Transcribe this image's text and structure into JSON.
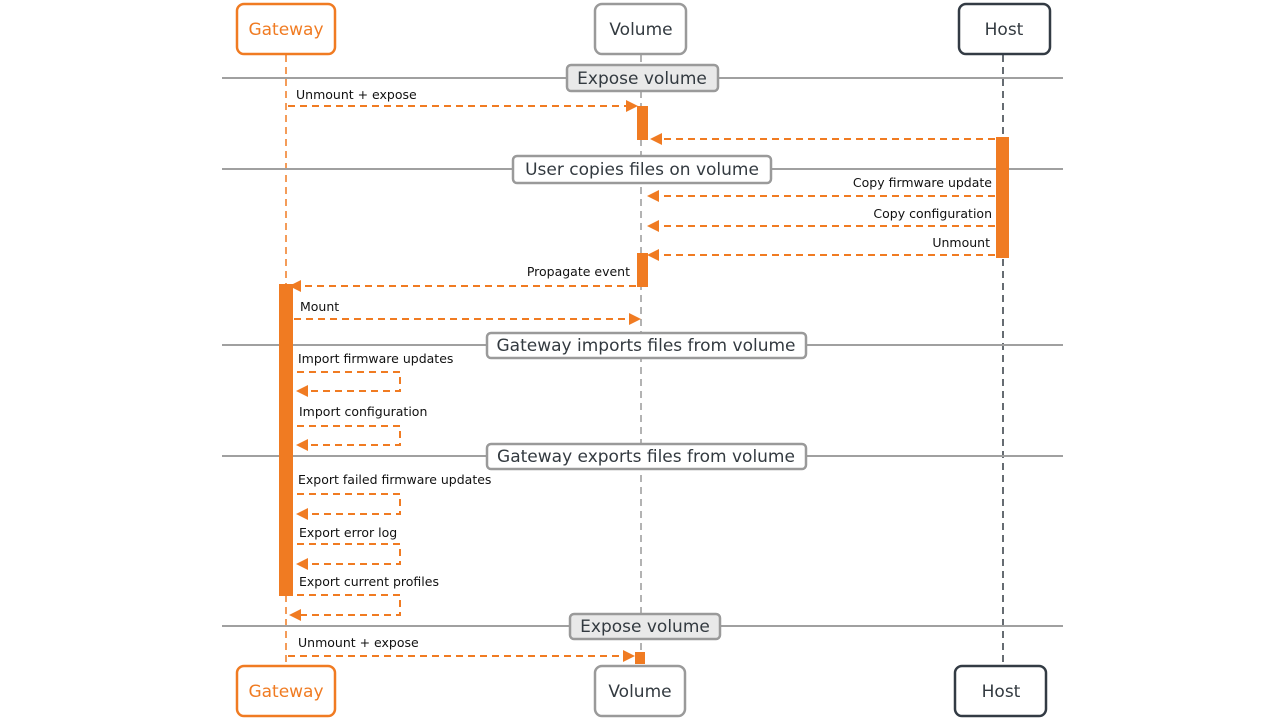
{
  "diagram": {
    "type": "sequence",
    "colors": {
      "accent": "#f07b22",
      "gateway": "#f07b22",
      "volume": "#9a9a9a",
      "host": "#333b44",
      "separator": "#a0a0a0",
      "group_fill_highlight": "#e9e9e9",
      "group_fill_plain": "#ffffff",
      "text": "#111111"
    },
    "actors": [
      {
        "id": "gateway",
        "label": "Gateway"
      },
      {
        "id": "volume",
        "label": "Volume"
      },
      {
        "id": "host",
        "label": "Host"
      }
    ],
    "groups": [
      {
        "label": "Expose volume",
        "highlight": true
      },
      {
        "label": "User copies files on volume",
        "highlight": false
      },
      {
        "label": "Gateway imports files from volume",
        "highlight": false
      },
      {
        "label": "Gateway exports files from volume",
        "highlight": false
      },
      {
        "label": "Expose volume",
        "highlight": true
      }
    ],
    "messages": [
      {
        "from": "gateway",
        "to": "volume",
        "label": "Unmount  + expose"
      },
      {
        "from": "host",
        "to": "volume",
        "label": ""
      },
      {
        "from": "host",
        "to": "volume",
        "label": "Copy firmware update"
      },
      {
        "from": "host",
        "to": "volume",
        "label": "Copy configuration"
      },
      {
        "from": "host",
        "to": "volume",
        "label": "Unmount"
      },
      {
        "from": "volume",
        "to": "gateway",
        "label": "Propagate event"
      },
      {
        "from": "gateway",
        "to": "volume",
        "label": "Mount"
      },
      {
        "from": "gateway",
        "to": "gateway",
        "label": "Import  firmware  updates"
      },
      {
        "from": "gateway",
        "to": "gateway",
        "label": "Import  configuration"
      },
      {
        "from": "gateway",
        "to": "gateway",
        "label": "Export failed firmware updates"
      },
      {
        "from": "gateway",
        "to": "gateway",
        "label": "Export  error  log"
      },
      {
        "from": "gateway",
        "to": "gateway",
        "label": "Export current profiles"
      },
      {
        "from": "gateway",
        "to": "volume",
        "label": "Unmount  + expose"
      }
    ]
  }
}
